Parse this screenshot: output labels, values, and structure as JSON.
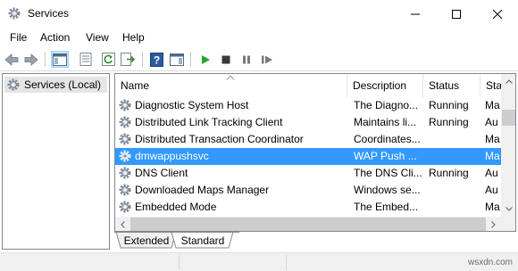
{
  "window": {
    "title": "Services",
    "title_icon": "services-gear-icon"
  },
  "menu": {
    "items": [
      {
        "label": "File"
      },
      {
        "label": "Action"
      },
      {
        "label": "View"
      },
      {
        "label": "Help"
      }
    ]
  },
  "toolbar": {
    "buttons": [
      {
        "icon": "back-arrow-icon"
      },
      {
        "icon": "forward-arrow-icon"
      },
      {
        "icon": "show-hide-console-tree-icon"
      },
      {
        "icon": "properties-icon"
      },
      {
        "icon": "refresh-icon"
      },
      {
        "icon": "export-list-icon"
      },
      {
        "icon": "help-icon"
      },
      {
        "icon": "show-hide-action-pane-icon"
      },
      {
        "icon": "start-service-icon"
      },
      {
        "icon": "stop-service-icon"
      },
      {
        "icon": "pause-service-icon"
      },
      {
        "icon": "restart-service-icon"
      }
    ]
  },
  "tree": {
    "root_label": "Services (Local)"
  },
  "table": {
    "columns": [
      {
        "label": "Name"
      },
      {
        "label": "Description"
      },
      {
        "label": "Status"
      },
      {
        "label": "Sta"
      }
    ],
    "rows": [
      {
        "name": "Diagnostic System Host",
        "description": "The Diagno...",
        "status": "Running",
        "startup": "Ma"
      },
      {
        "name": "Distributed Link Tracking Client",
        "description": "Maintains li...",
        "status": "Running",
        "startup": "Au"
      },
      {
        "name": "Distributed Transaction Coordinator",
        "description": "Coordinates...",
        "status": "",
        "startup": "Ma"
      },
      {
        "name": "dmwappushsvc",
        "description": "WAP Push ...",
        "status": "",
        "startup": "Ma"
      },
      {
        "name": "DNS Client",
        "description": "The DNS Cli...",
        "status": "Running",
        "startup": "Au"
      },
      {
        "name": "Downloaded Maps Manager",
        "description": "Windows se...",
        "status": "",
        "startup": "Au"
      },
      {
        "name": "Embedded Mode",
        "description": "The Embed...",
        "status": "",
        "startup": "Ma"
      }
    ],
    "selected_row": 3
  },
  "tabs": {
    "extended": "Extended",
    "standard": "Standard"
  },
  "watermark": "wsxdn.com",
  "colors": {
    "selection": "#3399ff",
    "start_green": "#2aa12a"
  }
}
